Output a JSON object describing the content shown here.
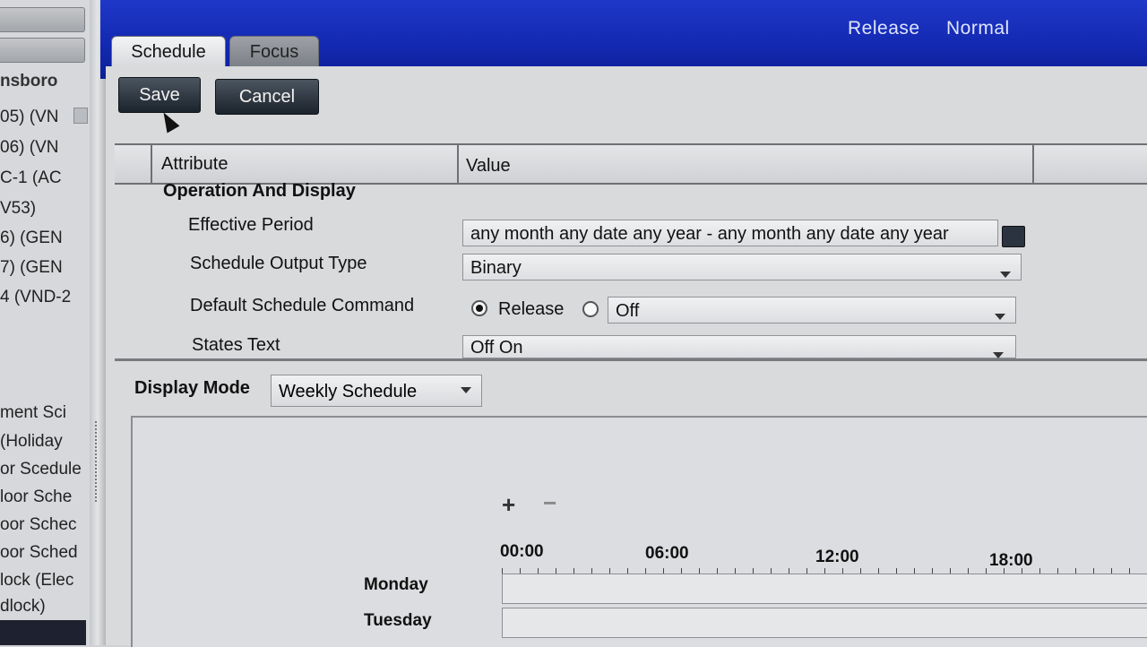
{
  "left_tree": {
    "items": [
      {
        "label": "nsboro"
      },
      {
        "label": "05) (VN"
      },
      {
        "label": "06) (VN"
      },
      {
        "label": "C-1 (AC"
      },
      {
        "label": "V53)"
      },
      {
        "label": "6) (GEN"
      },
      {
        "label": "7) (GEN"
      },
      {
        "label": "4 (VND-2"
      },
      {
        "label": "ment Sci"
      },
      {
        "label": "(Holiday"
      },
      {
        "label": "or Scedule"
      },
      {
        "label": "loor Sche"
      },
      {
        "label": "oor Schec"
      },
      {
        "label": "oor Sched"
      },
      {
        "label": "lock (Elec"
      },
      {
        "label": "dlock)"
      }
    ]
  },
  "header": {
    "status_release": "Release",
    "status_normal": "Normal"
  },
  "tabs": [
    {
      "label": "Schedule",
      "active": true
    },
    {
      "label": "Focus",
      "active": false
    }
  ],
  "toolbar": {
    "save_label": "Save",
    "cancel_label": "Cancel"
  },
  "grid": {
    "col_attribute": "Attribute",
    "col_value": "Value",
    "group_label": "Operation And Display",
    "rows": [
      {
        "label": "Effective Period",
        "value": "any month any date any year  -  any month any date any year"
      },
      {
        "label": "Schedule Output Type",
        "value": "Binary"
      },
      {
        "label": "Default Schedule Command",
        "option_selected": "Release",
        "option_other": "Off"
      },
      {
        "label": "States Text",
        "value": "Off On"
      }
    ]
  },
  "display_mode": {
    "label": "Display Mode",
    "value": "Weekly Schedule"
  },
  "schedule": {
    "zoom_in": "+",
    "zoom_out": "−",
    "times": [
      "00:00",
      "06:00",
      "12:00",
      "18:00"
    ],
    "days": [
      "Monday",
      "Tuesday"
    ]
  },
  "colors": {
    "header_blue": "#1228b0",
    "button_dark": "#1b232c"
  }
}
